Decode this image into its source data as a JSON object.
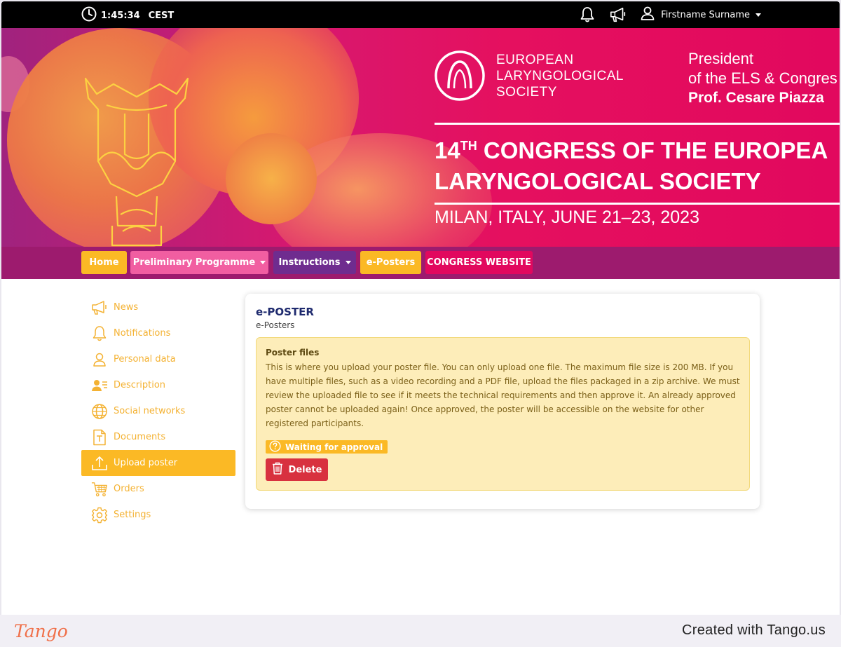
{
  "topbar": {
    "time": "1:45:34",
    "timezone": "CEST",
    "user_name": "Firstname Surname",
    "icons": [
      "clock-icon",
      "bell-icon",
      "megaphone-icon",
      "user-icon"
    ]
  },
  "banner": {
    "society_line1": "EUROPEAN",
    "society_line2": "LARYNGOLOGICAL",
    "society_line3": "SOCIETY",
    "president_line1": "President",
    "president_line2": "of the ELS & Congres",
    "president_line3": "Prof. Cesare Piazza",
    "congress_number": "14",
    "congress_ordinal": "TH",
    "congress_line1_rest": " CONGRESS OF THE EUROPEA",
    "congress_line2": "LARYNGOLOGICAL SOCIETY",
    "dates": "MILAN, ITALY, JUNE 21–23, 2023",
    "colors": {
      "magenta": "#e2085e",
      "purple": "#9d1b6e",
      "orange": "#f3a148"
    }
  },
  "nav": {
    "home": "Home",
    "preliminary": "Preliminary Programme",
    "instructions": "Instructions",
    "eposters": "e-Posters",
    "congress_website": "CONGRESS WEBSITE",
    "colors": {
      "home": "#fbb925",
      "preliminary": "#f15ea1",
      "instructions": "#6f2c8f",
      "eposters": "#fbb925",
      "congress": "#e2085e"
    }
  },
  "sidebar": {
    "items": [
      {
        "label": "News",
        "icon": "megaphone-icon"
      },
      {
        "label": "Notifications",
        "icon": "bell-icon"
      },
      {
        "label": "Personal data",
        "icon": "user-icon"
      },
      {
        "label": "Description",
        "icon": "user-list-icon"
      },
      {
        "label": "Social networks",
        "icon": "globe-icon"
      },
      {
        "label": "Documents",
        "icon": "document-icon"
      },
      {
        "label": "Upload poster",
        "icon": "upload-icon",
        "active": true
      },
      {
        "label": "Orders",
        "icon": "cart-icon"
      },
      {
        "label": "Settings",
        "icon": "gear-icon"
      }
    ]
  },
  "card": {
    "title": "e-POSTER",
    "subtitle": "e-Posters",
    "notice_title": "Poster files",
    "notice_body": "This is where you upload your poster file. You can only upload one file. The maximum file size is 200 MB. If you have multiple files, such as a video recording and a PDF file, upload the files packaged in a zip archive. We must review the uploaded file to see if it meets the technical requirements and then approve it. An already approved poster cannot be uploaded again! Once approved, the poster will be accessible on the website for other registered participants.",
    "status": "Waiting for approval",
    "delete_label": "Delete"
  },
  "footer": {
    "logo": "Tango",
    "created": "Created with Tango.us"
  }
}
